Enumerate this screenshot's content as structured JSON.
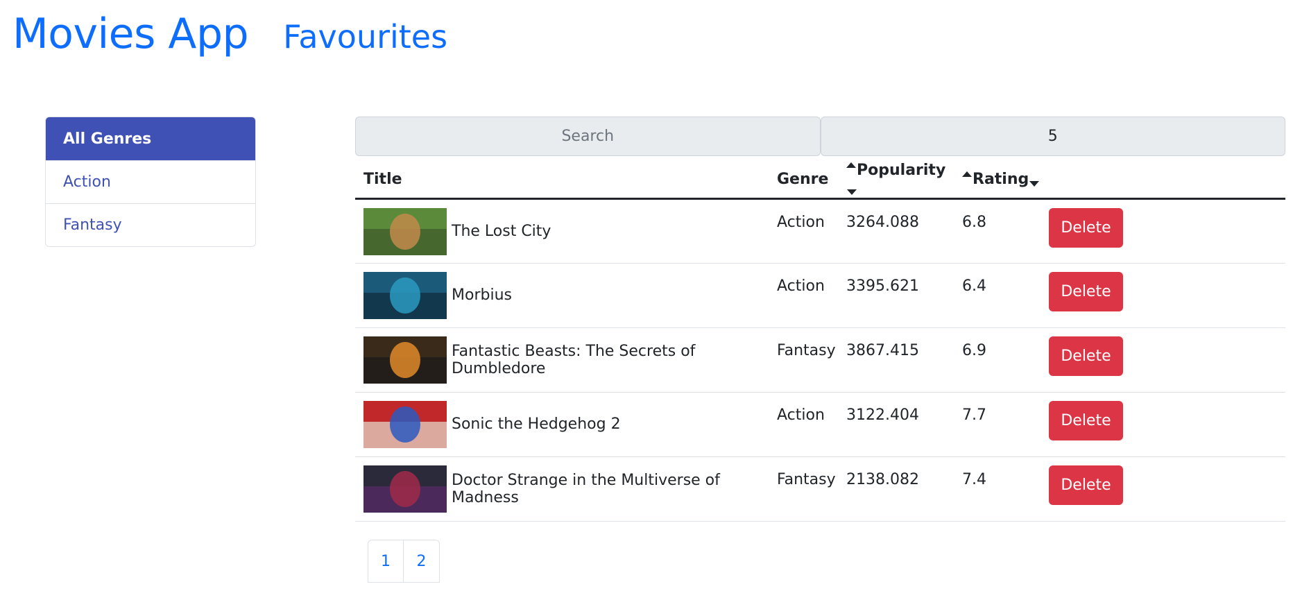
{
  "header": {
    "brand": "Movies App",
    "nav_favourites": "Favourites"
  },
  "genres": [
    "All Genres",
    "Action",
    "Fantasy"
  ],
  "controls": {
    "search_placeholder": "Search",
    "page_size_value": "5"
  },
  "table": {
    "headers": {
      "title": "Title",
      "genre": "Genre",
      "popularity": "Popularity",
      "rating": "Rating"
    },
    "rows": [
      {
        "title": "The Lost City",
        "genre": "Action",
        "popularity": "3264.088",
        "rating": "6.8",
        "delete_label": "Delete",
        "poster_colors": [
          "#5a8a3a",
          "#c28a4a",
          "#3d5a2a"
        ]
      },
      {
        "title": "Morbius",
        "genre": "Action",
        "popularity": "3395.621",
        "rating": "6.4",
        "delete_label": "Delete",
        "poster_colors": [
          "#1c5a7a",
          "#2a9ac0",
          "#0d2a3a"
        ]
      },
      {
        "title": "Fantastic Beasts: The Secrets of Dumbledore",
        "genre": "Fantasy",
        "popularity": "3867.415",
        "rating": "6.9",
        "delete_label": "Delete",
        "poster_colors": [
          "#3a2a1a",
          "#e08a2a",
          "#1a1a1a"
        ]
      },
      {
        "title": "Sonic the Hedgehog 2",
        "genre": "Action",
        "popularity": "3122.404",
        "rating": "7.7",
        "delete_label": "Delete",
        "poster_colors": [
          "#c0282a",
          "#2a5ac0",
          "#e8e0d0"
        ]
      },
      {
        "title": "Doctor Strange in the Multiverse of Madness",
        "genre": "Fantasy",
        "popularity": "2138.082",
        "rating": "7.4",
        "delete_label": "Delete",
        "poster_colors": [
          "#2a2a3a",
          "#a02a4a",
          "#5a2a6a"
        ]
      }
    ]
  },
  "pagination": [
    "1",
    "2"
  ]
}
